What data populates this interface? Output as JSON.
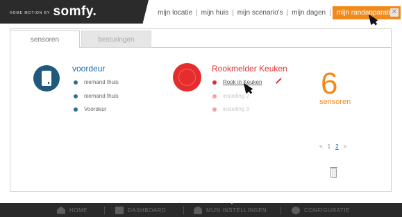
{
  "brand": {
    "tagline": "HOME MOTION BY",
    "logo": "somfy."
  },
  "topnav": {
    "items": [
      "mijn locatie",
      "mijn huis",
      "mijn scenario's",
      "mijn dagen",
      "mijn randapparaten"
    ],
    "separator": "|",
    "active_index": 4,
    "close_symbol": "✕"
  },
  "tabs": [
    "sensoren",
    "besturingen"
  ],
  "groups": {
    "door": {
      "title": "voordeur",
      "items": [
        "niemand thuis",
        "niemand thuis",
        "Voordeur"
      ]
    },
    "smoke": {
      "title": "Rookmelder Keuken",
      "items": [
        "Rook in Keuken",
        "instelling 2",
        "instelling 3"
      ]
    }
  },
  "summary": {
    "count": "6",
    "label": "sensoren"
  },
  "pager": {
    "prev": "<",
    "page1": "1",
    "page2": "2",
    "next": ">"
  },
  "bottomnav": [
    "HOME",
    "DASHBOARD",
    "MIJN INSTELLINGEN",
    "CONFIGURATIE"
  ],
  "colors": {
    "accent": "#f28a1b",
    "door_blue": "#1f5a7a",
    "smoke_red": "#e52d2d",
    "topbar_dark": "#2b2b2b"
  }
}
